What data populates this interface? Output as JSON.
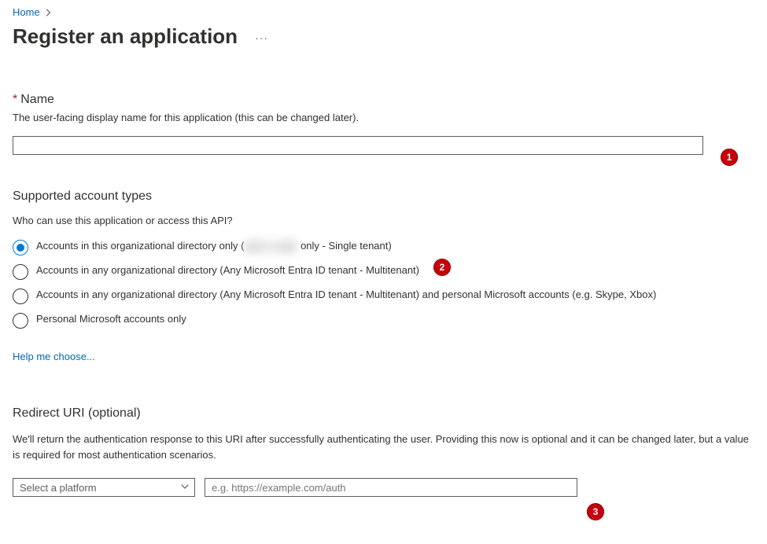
{
  "breadcrumb": {
    "home": "Home"
  },
  "page": {
    "title": "Register an application"
  },
  "name_section": {
    "asterisk": "*",
    "label": "Name",
    "help": "The user-facing display name for this application (this can be changed later).",
    "value": ""
  },
  "accounts_section": {
    "heading": "Supported account types",
    "question": "Who can use this application or access this API?",
    "options": {
      "org_only_prefix": "Accounts in this organizational directory only (",
      "org_only_suffix": " only - Single tenant)",
      "any_org": "Accounts in any organizational directory (Any Microsoft Entra ID tenant - Multitenant)",
      "any_org_and_personal": "Accounts in any organizational directory (Any Microsoft Entra ID tenant - Multitenant) and personal Microsoft accounts (e.g. Skype, Xbox)",
      "personal_only": "Personal Microsoft accounts only"
    },
    "help_link": "Help me choose..."
  },
  "redirect_section": {
    "heading": "Redirect URI (optional)",
    "description": "We'll return the authentication response to this URI after successfully authenticating the user. Providing this now is optional and it can be changed later, but a value is required for most authentication scenarios.",
    "platform_placeholder": "Select a platform",
    "uri_placeholder": "e.g. https://example.com/auth",
    "uri_value": ""
  },
  "callouts": {
    "c1": "1",
    "c2": "2",
    "c3": "3"
  }
}
